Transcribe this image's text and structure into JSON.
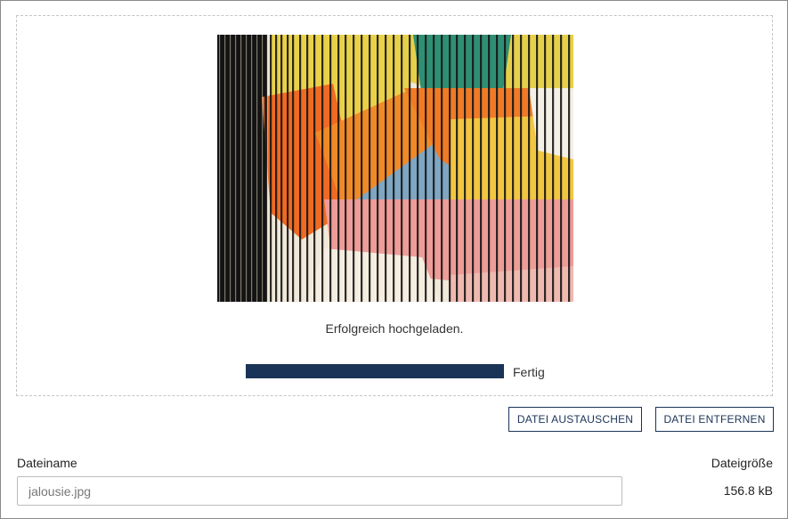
{
  "upload": {
    "image_alt": "jalousie.jpg",
    "status_message": "Erfolgreich hochgeladen.",
    "progress": {
      "fraction": 1.0,
      "label": "Fertig"
    }
  },
  "actions": {
    "replace_label": "DATEI AUSTAUSCHEN",
    "remove_label": "DATEI ENTFERNEN"
  },
  "file": {
    "name_label": "Dateiname",
    "name_value": "jalousie.jpg",
    "size_label": "Dateigröße",
    "size_value": "156.8 kB"
  },
  "colors": {
    "accent": "#1a3457",
    "dropzone_border": "#c4c4c4"
  }
}
